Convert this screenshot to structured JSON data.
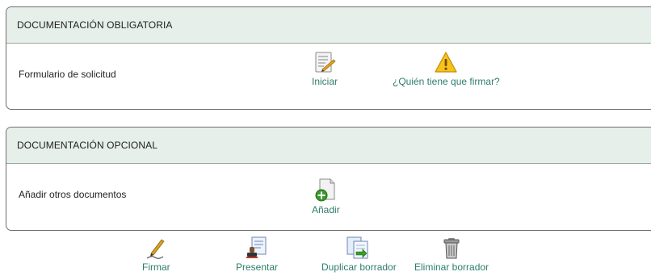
{
  "mandatory": {
    "title": "DOCUMENTACIÓN OBLIGATORIA",
    "row_label": "Formulario de solicitud",
    "start_label": "Iniciar",
    "who_signs_label": "¿Quién tiene que firmar?"
  },
  "optional": {
    "title": "DOCUMENTACIÓN OPCIONAL",
    "row_label": "Añadir otros documentos",
    "add_label": "Añadir"
  },
  "toolbar": {
    "sign_label": "Firmar",
    "submit_label": "Presentar",
    "duplicate_label": "Duplicar borrador",
    "delete_label": "Eliminar borrador"
  },
  "colors": {
    "header_bg": "#e6efe9",
    "link": "#2e7d6b",
    "warning": "#f2b705"
  },
  "icons": {
    "start": "form-edit-icon",
    "who_signs": "warning-icon",
    "add": "add-document-icon",
    "sign": "pen-icon",
    "submit": "stamp-document-icon",
    "duplicate": "duplicate-document-icon",
    "delete": "trash-icon"
  }
}
